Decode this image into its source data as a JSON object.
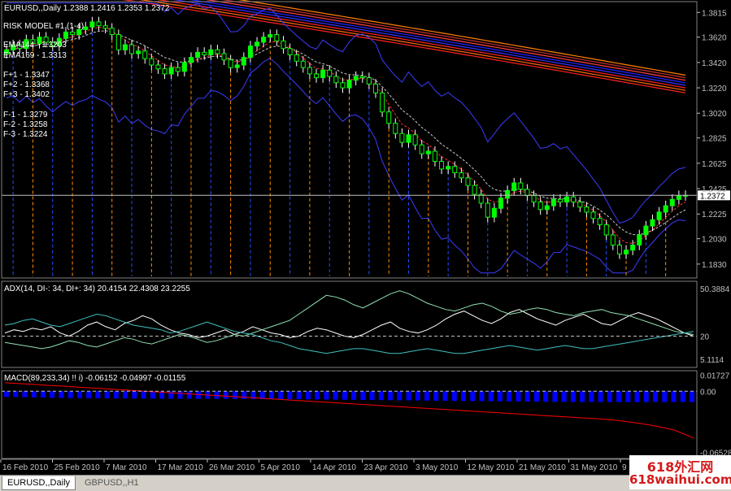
{
  "window": {
    "tabs": [
      {
        "label": "EURUSD,,Daily",
        "active": true
      },
      {
        "label": "GBPUSD,,H1",
        "active": false
      }
    ]
  },
  "watermark": {
    "line1": "618外汇网",
    "line2": "618waihui.com"
  },
  "colors": {
    "background": "#000000",
    "axis": "#c0c0c0",
    "candle_up": "#ffffff",
    "candle_body_fill": "#00ff00",
    "bollinger": "#3c3cff",
    "ema_fast": "#ff3030",
    "ema_slow": "#c8c8c8",
    "fractal_up": "#ff8c00",
    "fractal_down": "#2050ff",
    "adx": "#ffffff",
    "di_minus": "#40c0c0",
    "di_plus": "#90e0b0",
    "macd_hist": "#0000ff",
    "macd_signal": "#ff0000"
  },
  "chart_data": [
    {
      "type": "candlestick",
      "title": "EURUSD,,Daily  1.2388 1.2416 1.2353 1.2372",
      "overlay_labels": [
        "RISK MODEL #1 (1-4)",
        "EMA144 - 1.3203",
        "EMA169 - 1.3313",
        "F+1 - 1.3347",
        "F+2 - 1.3368",
        "F+3 - 1.3402",
        "F-1 - 1.3279",
        "F-2 - 1.3258",
        "F-3 - 1.3224"
      ],
      "ylim": [
        1.172,
        1.39
      ],
      "yticks": [
        1.3815,
        1.362,
        1.342,
        1.322,
        1.302,
        1.2825,
        1.2625,
        1.2425,
        1.2225,
        1.203,
        1.183
      ],
      "ytick_labels": [
        "1.3815",
        "1.3620",
        "1.3420",
        "1.3220",
        "1.3020",
        "1.2825",
        "1.2625",
        "1.2425",
        "1.2225",
        "1.2030",
        "1.1830"
      ],
      "current_price": 1.2372,
      "current_price_label": "1.2372",
      "x_labels": [
        "16 Feb 2010",
        "25 Feb 2010",
        "7 Mar 2010",
        "17 Mar 2010",
        "26 Mar 2010",
        "5 Apr 2010",
        "14 Apr 2010",
        "23 Apr 2010",
        "3 May 2010",
        "12 May 2010",
        "21 May 2010",
        "31 May 2010",
        "9"
      ],
      "closes": [
        1.352,
        1.356,
        1.353,
        1.36,
        1.357,
        1.362,
        1.358,
        1.355,
        1.361,
        1.366,
        1.364,
        1.368,
        1.37,
        1.374,
        1.371,
        1.369,
        1.364,
        1.352,
        1.356,
        1.349,
        1.351,
        1.345,
        1.34,
        1.337,
        1.333,
        1.338,
        1.335,
        1.342,
        1.346,
        1.35,
        1.348,
        1.352,
        1.349,
        1.344,
        1.338,
        1.34,
        1.346,
        1.355,
        1.358,
        1.362,
        1.364,
        1.359,
        1.353,
        1.348,
        1.343,
        1.338,
        1.333,
        1.33,
        1.336,
        1.331,
        1.326,
        1.322,
        1.328,
        1.331,
        1.33,
        1.325,
        1.318,
        1.303,
        1.294,
        1.286,
        1.279,
        1.285,
        1.277,
        1.27,
        1.272,
        1.264,
        1.258,
        1.26,
        1.255,
        1.251,
        1.245,
        1.238,
        1.231,
        1.22,
        1.227,
        1.235,
        1.241,
        1.247,
        1.242,
        1.237,
        1.232,
        1.226,
        1.229,
        1.234,
        1.232,
        1.236,
        1.232,
        1.228,
        1.224,
        1.219,
        1.214,
        1.206,
        1.198,
        1.191,
        1.194,
        1.198,
        1.206,
        1.213,
        1.218,
        1.224,
        1.229,
        1.234,
        1.237,
        1.2372
      ],
      "bollinger_upper_note": "upper band declines from ~1.392 to ~1.26, lower band from ~1.34 to ~1.185"
    },
    {
      "type": "line",
      "title": "ADX(14, DI-: 34, DI+: 34) 20.4154 22.4308 23.2255",
      "ylim": [
        0,
        55
      ],
      "ytick_labels": [
        "50.3884",
        "20",
        "5.1114"
      ],
      "yticks": [
        50.3884,
        20,
        5.1114
      ],
      "level_line": 20,
      "series": [
        {
          "values": [
            22,
            24,
            23,
            25,
            24,
            26,
            22,
            20,
            23,
            27,
            29,
            26,
            24,
            28,
            30,
            33,
            31,
            27,
            24,
            22,
            21,
            19,
            20,
            22,
            24,
            21,
            23,
            26,
            24,
            22,
            21,
            19,
            20,
            23,
            25,
            24,
            22,
            20,
            19,
            21,
            24,
            27,
            29,
            25,
            23,
            22,
            24,
            27,
            31,
            34,
            36,
            33,
            30,
            28,
            31,
            35,
            37,
            34,
            31,
            29,
            27,
            30,
            32,
            34,
            31,
            28,
            27,
            30,
            33,
            35,
            33,
            31,
            28,
            25,
            22,
            20
          ]
        },
        {
          "values": [
            16,
            15,
            14,
            13,
            12,
            13,
            15,
            17,
            16,
            14,
            13,
            15,
            17,
            19,
            18,
            16,
            15,
            17,
            19,
            21,
            20,
            18,
            16,
            17,
            19,
            21,
            20,
            22,
            24,
            26,
            28,
            30,
            34,
            38,
            42,
            46,
            45,
            43,
            40,
            38,
            41,
            44,
            47,
            49,
            47,
            44,
            41,
            39,
            37,
            36,
            38,
            40,
            41,
            39,
            36,
            34,
            35,
            37,
            38,
            37,
            35,
            34,
            33,
            35,
            36,
            37,
            35,
            34,
            33,
            31,
            29,
            27,
            25,
            23,
            22,
            21
          ]
        },
        {
          "values": [
            27,
            28,
            30,
            31,
            29,
            27,
            26,
            28,
            30,
            32,
            34,
            33,
            31,
            29,
            27,
            26,
            25,
            24,
            22,
            23,
            25,
            27,
            29,
            27,
            25,
            23,
            22,
            21,
            19,
            17,
            16,
            14,
            12,
            11,
            10,
            9,
            10,
            11,
            12,
            12,
            11,
            10,
            9,
            9,
            10,
            11,
            12,
            11,
            10,
            9,
            9,
            10,
            11,
            12,
            13,
            14,
            13,
            12,
            11,
            12,
            13,
            14,
            13,
            12,
            12,
            13,
            14,
            15,
            16,
            17,
            18,
            19,
            20,
            21,
            22,
            23
          ]
        }
      ]
    },
    {
      "type": "bar",
      "title": "MACD(89,233,34)      !! i) -0.06152 -0.04997 -0.01155",
      "ylim": [
        -0.072,
        0.022
      ],
      "ytick_labels": [
        "0.01727",
        "0.00",
        "-0.06528"
      ],
      "yticks": [
        0.01727,
        0.0,
        -0.06528
      ],
      "zero_line": 0.0,
      "series": [
        {
          "values": [
            -0.006,
            -0.0062,
            -0.0064,
            -0.0066,
            -0.0068,
            -0.007,
            -0.0072,
            -0.0073,
            -0.0074,
            -0.0075,
            -0.0076,
            -0.0076,
            -0.0077,
            -0.0077,
            -0.0078,
            -0.0078,
            -0.0079,
            -0.0079,
            -0.008,
            -0.008,
            -0.008,
            -0.0081,
            -0.0081,
            -0.0082,
            -0.0082,
            -0.0083,
            -0.0083,
            -0.0084,
            -0.0084,
            -0.0085,
            -0.0085,
            -0.0086,
            -0.0086,
            -0.0087,
            -0.0088,
            -0.0089,
            -0.009,
            -0.0091,
            -0.0092,
            -0.0093,
            -0.0094,
            -0.0095,
            -0.0096,
            -0.0097,
            -0.0098,
            -0.0099,
            -0.01,
            -0.0101,
            -0.0102,
            -0.0103,
            -0.0104,
            -0.0105,
            -0.0106,
            -0.0107,
            -0.0108,
            -0.0109,
            -0.011,
            -0.0111,
            -0.0112,
            -0.0113,
            -0.0114,
            -0.0114,
            -0.0115,
            -0.0115,
            -0.0115,
            -0.0116,
            -0.0116,
            -0.0116,
            -0.0116,
            -0.0116,
            -0.0116,
            -0.0116,
            -0.0116,
            -0.0115,
            -0.0115,
            -0.01155
          ]
        },
        {
          "values": [
            0.009,
            0.0085,
            0.008,
            0.0074,
            0.0068,
            0.0062,
            0.0056,
            0.005,
            0.0044,
            0.0038,
            0.0032,
            0.0026,
            0.002,
            0.0014,
            0.0008,
            0.0002,
            -0.0004,
            -0.001,
            -0.0016,
            -0.0022,
            -0.0028,
            -0.0034,
            -0.004,
            -0.0046,
            -0.0052,
            -0.0058,
            -0.0064,
            -0.007,
            -0.0076,
            -0.0082,
            -0.0088,
            -0.0094,
            -0.01,
            -0.0106,
            -0.0112,
            -0.0118,
            -0.0124,
            -0.013,
            -0.0136,
            -0.0142,
            -0.0148,
            -0.0154,
            -0.016,
            -0.0166,
            -0.0172,
            -0.0178,
            -0.0184,
            -0.019,
            -0.0196,
            -0.0202,
            -0.0208,
            -0.0214,
            -0.022,
            -0.0226,
            -0.0232,
            -0.0238,
            -0.0244,
            -0.025,
            -0.0256,
            -0.0262,
            -0.0268,
            -0.0274,
            -0.028,
            -0.0286,
            -0.0292,
            -0.0298,
            -0.0306,
            -0.0316,
            -0.0328,
            -0.0342,
            -0.0358,
            -0.0376,
            -0.0396,
            -0.042,
            -0.046,
            -0.05
          ]
        }
      ]
    }
  ]
}
